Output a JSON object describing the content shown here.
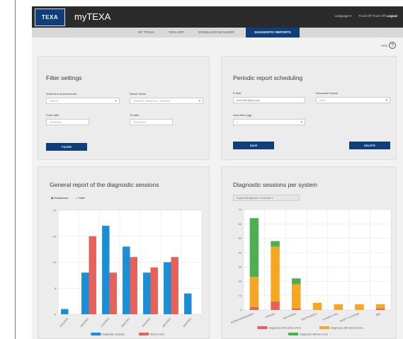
{
  "app": {
    "logo_text": "TEXA",
    "title": "myTEXA"
  },
  "top_links": {
    "language": "Language ▾",
    "user": "Truck Off Truck Off",
    "logout": "Logout"
  },
  "nav": {
    "items": [
      {
        "label": "MY TOOLS"
      },
      {
        "label": "TEXA APP"
      },
      {
        "label": "DOWNLOAD MANAGER"
      },
      {
        "label": "DIAGNOSTIC REPORTS"
      }
    ],
    "active_index": 3
  },
  "help": {
    "label": "Help",
    "icon": "help-circle-icon"
  },
  "filter": {
    "title": "Filter settings",
    "env_label": "Select the environments",
    "env_value": "TRUCK",
    "serial_label": "Select Serial",
    "serial_value": "S3453/ST, M06/ST/3C, 3402/23/4",
    "from_label": "From date",
    "from_value": "23/03/2021",
    "to_label": "To date",
    "to_value": "23/04/2021",
    "button": "FILTER"
  },
  "schedule": {
    "title": "Periodic report scheduling",
    "email_label": "E-Mail",
    "email_value": "truck.offer@texa.com",
    "format_label": "Document format",
    "format_value": "Excel",
    "how_label": "How often (gg)",
    "how_value": "1",
    "save": "SAVE",
    "delete": "DELETE"
  },
  "general": {
    "title": "General report of the diagnostic sessions",
    "views": [
      "Dashboard",
      "Table"
    ],
    "selected_view": "Dashboard"
  },
  "persystem": {
    "title": "Diagnostic sessions per system",
    "dropdown": "Engine Management, Generator ▾"
  },
  "colors": {
    "brand": "#0e3f7a",
    "blue": "#1a8fd6",
    "red": "#e8605a",
    "green": "#4caf50",
    "orange": "#f5a623"
  },
  "chart_data": [
    {
      "type": "bar",
      "categories": [
        "23/01/2021",
        "26/01/2021",
        "27/01/2021",
        "28/01/2021",
        "29/01/2021",
        "30/01/2021",
        "09/02/2021"
      ],
      "series": [
        {
          "name": "Diagnostic sessions",
          "values": [
            1,
            8,
            17,
            13,
            8,
            10,
            4
          ],
          "color": "#1a8fd6"
        },
        {
          "name": "Active errors",
          "values": [
            0,
            15,
            8,
            11,
            9,
            11,
            0
          ],
          "color": "#e8605a"
        }
      ],
      "ylim": [
        0,
        20
      ],
      "yticks": [
        0,
        5,
        10,
        15,
        20
      ],
      "grid": true,
      "legend": "bottom"
    },
    {
      "type": "bar",
      "stacked": true,
      "categories": [
        "ENGINE MANAGEMENT",
        "CHASSIS",
        "BODYWORK",
        "INSTRUMENTS",
        "CLIMATE CTRL",
        "SAFETY SYSTEMS",
        "ABS"
      ],
      "series": [
        {
          "name": "Diagnoses with active errors",
          "values": [
            2,
            6,
            1,
            0,
            0,
            0,
            1
          ],
          "color": "#e8605a"
        },
        {
          "name": "Diagnoses with stored errors",
          "values": [
            21,
            38,
            17,
            5,
            4,
            4,
            3
          ],
          "color": "#f5a623"
        },
        {
          "name": "Diagnoses without errors",
          "values": [
            41,
            4,
            4,
            0,
            0,
            0,
            0
          ],
          "color": "#4caf50"
        }
      ],
      "ylim": [
        0,
        70
      ],
      "yticks": [
        0,
        10,
        20,
        30,
        40,
        50,
        60,
        70
      ],
      "grid": true,
      "legend": "bottom"
    }
  ]
}
